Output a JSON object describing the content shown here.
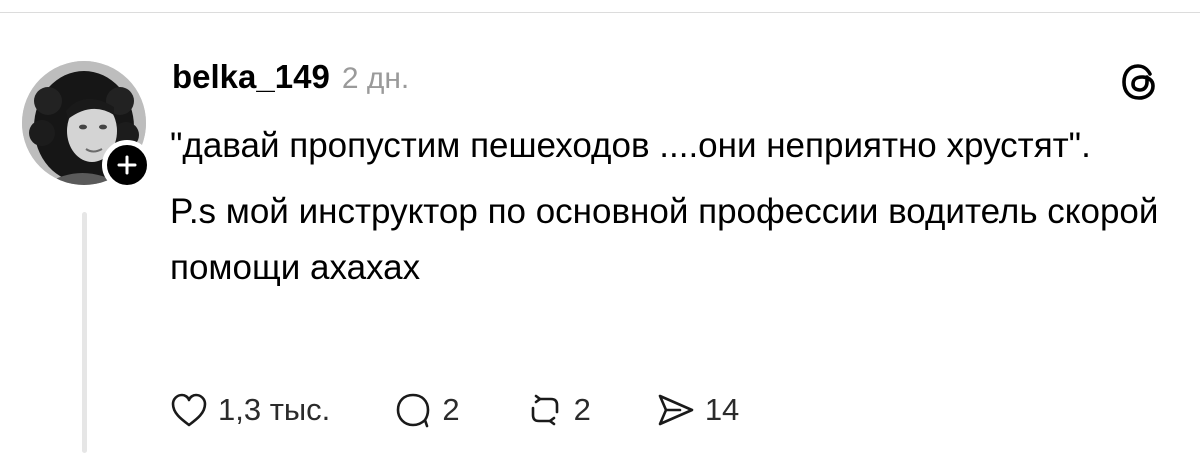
{
  "post": {
    "username": "belka_149",
    "time": "2 дн.",
    "text": [
      "\"давай пропустим пешеходов ....они неприятно хрустят\".",
      "P.s мой инструктор по основной профессии водитель скорой помощи ахахах"
    ]
  },
  "actions": {
    "likes": "1,3 тыс.",
    "comments": "2",
    "reposts": "2",
    "shares": "14"
  },
  "icons": {
    "avatar": "profile-photo",
    "follow": "plus-icon",
    "logo": "threads-logo-icon",
    "like": "heart-icon",
    "comment": "comment-bubble-icon",
    "repost": "repost-icon",
    "share": "send-icon"
  },
  "colors": {
    "text": "#000000",
    "muted": "#9a9a9a",
    "thread_line": "#e6e6e6"
  }
}
